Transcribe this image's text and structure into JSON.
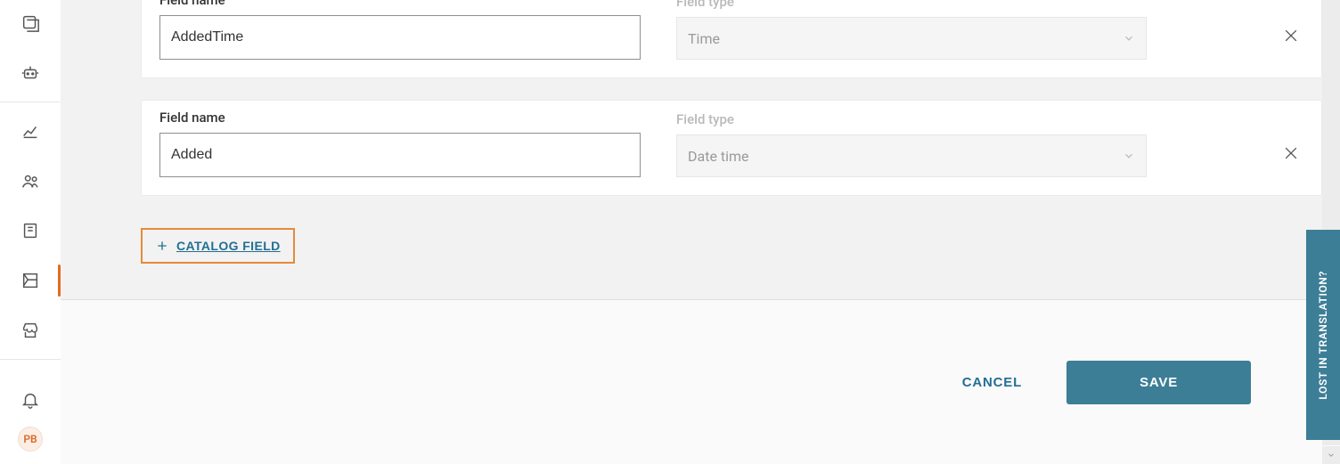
{
  "sidebar": {
    "avatar_initials": "PB"
  },
  "fields": [
    {
      "field_name_label": "Field name",
      "field_name_value": "AddedTime",
      "field_type_label": "Field type",
      "field_type_value": "Time"
    },
    {
      "field_name_label": "Field name",
      "field_name_value": "Added",
      "field_type_label": "Field type",
      "field_type_value": "Date time"
    }
  ],
  "actions": {
    "add_catalog_field": "CATALOG FIELD",
    "cancel": "CANCEL",
    "save": "SAVE"
  },
  "side_tab": {
    "label": "LOST IN TRANSLATION?"
  }
}
